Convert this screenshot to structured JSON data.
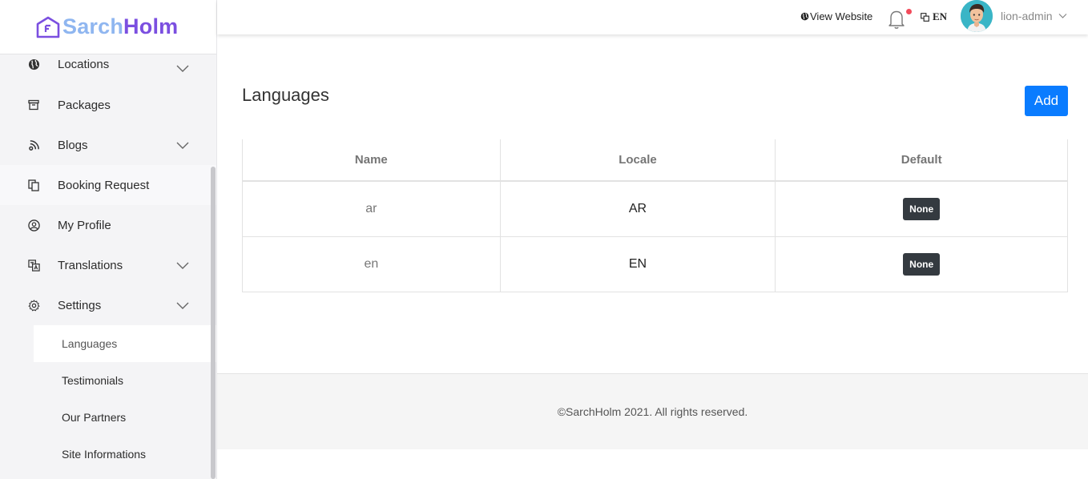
{
  "brand": {
    "name_part1": "Sarch",
    "name_part2": "Holm",
    "color_light": "#8fb6f0",
    "color_dark": "#7b4fe0"
  },
  "topbar": {
    "view_website": "View Website",
    "language": "EN",
    "user_name": "lion-admin",
    "notification_dot_color": "#f24b5b"
  },
  "sidebar": {
    "items": [
      {
        "label": "Locations",
        "icon": "globe-icon",
        "has_submenu": true
      },
      {
        "label": "Packages",
        "icon": "archive-icon",
        "has_submenu": false
      },
      {
        "label": "Blogs",
        "icon": "feed-icon",
        "has_submenu": true
      },
      {
        "label": "Booking Request",
        "icon": "copy-icon",
        "has_submenu": false
      },
      {
        "label": "My Profile",
        "icon": "user-circle-icon",
        "has_submenu": false
      },
      {
        "label": "Translations",
        "icon": "translate-icon",
        "has_submenu": true
      },
      {
        "label": "Settings",
        "icon": "gear-icon",
        "has_submenu": true
      }
    ],
    "settings_submenu": [
      {
        "label": "Languages",
        "active": true
      },
      {
        "label": "Testimonials",
        "active": false
      },
      {
        "label": "Our Partners",
        "active": false
      },
      {
        "label": "Site Informations",
        "active": false
      }
    ]
  },
  "main": {
    "title": "Languages",
    "add_label": "Add",
    "accent_color": "#0a7cff",
    "table": {
      "headers": [
        "Name",
        "Locale",
        "Default"
      ],
      "rows": [
        {
          "name": "ar",
          "locale": "AR",
          "default": "None"
        },
        {
          "name": "en",
          "locale": "EN",
          "default": "None"
        }
      ]
    }
  },
  "footer": {
    "text": "©SarchHolm 2021. All rights reserved."
  }
}
